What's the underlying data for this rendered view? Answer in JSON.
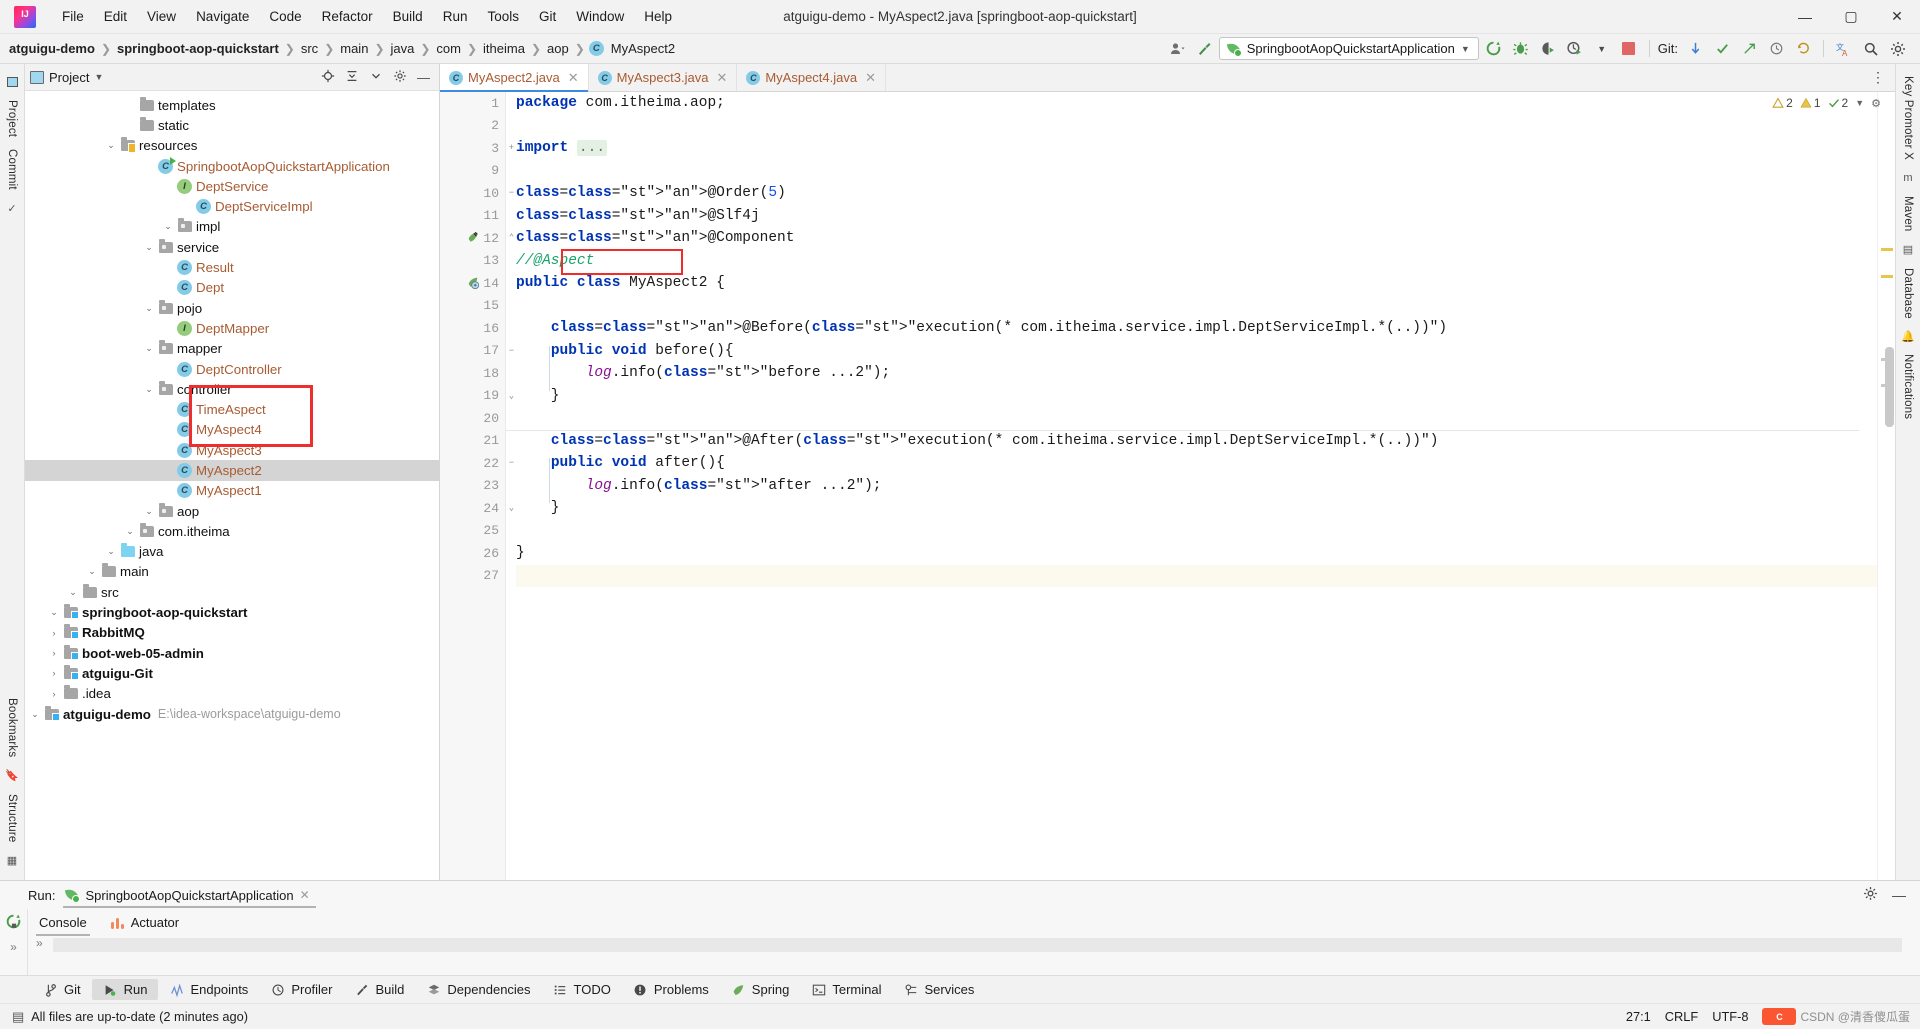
{
  "window": {
    "title": "atguigu-demo - MyAspect2.java [springboot-aop-quickstart]",
    "minimize": "—",
    "maximize": "▢",
    "close": "✕"
  },
  "menu": [
    "File",
    "Edit",
    "View",
    "Navigate",
    "Code",
    "Refactor",
    "Build",
    "Run",
    "Tools",
    "Git",
    "Window",
    "Help"
  ],
  "breadcrumb": [
    "atguigu-demo",
    "springboot-aop-quickstart",
    "src",
    "main",
    "java",
    "com",
    "itheima",
    "aop",
    "MyAspect2"
  ],
  "toolbar": {
    "run_config": "SpringbootAopQuickstartApplication",
    "git_label": "Git:",
    "icons": [
      "user-icon",
      "hammer-icon",
      "rerun-icon",
      "debug-icon",
      "coverage-icon",
      "profile-icon",
      "stop-icon",
      "git-update-icon",
      "git-commit-icon",
      "git-push-icon",
      "git-history-icon",
      "git-rollback-icon",
      "translate-icon",
      "search-icon",
      "settings-icon"
    ]
  },
  "project_panel": {
    "title": "Project",
    "header_icons": [
      "locate-icon",
      "collapse-all-icon",
      "expand-icon",
      "settings-icon",
      "hide-icon"
    ],
    "tree": [
      {
        "depth": 0,
        "label": "atguigu-demo",
        "path": "E:\\idea-workspace\\atguigu-demo",
        "icon": "module-folder",
        "arrow": "open",
        "bold": true
      },
      {
        "depth": 1,
        "label": ".idea",
        "icon": "folder",
        "arrow": "closed"
      },
      {
        "depth": 1,
        "label": "atguigu-Git",
        "icon": "module-folder",
        "arrow": "closed",
        "bold": true
      },
      {
        "depth": 1,
        "label": "boot-web-05-admin",
        "icon": "module-folder",
        "arrow": "closed",
        "bold": true
      },
      {
        "depth": 1,
        "label": "RabbitMQ",
        "icon": "module-folder",
        "arrow": "closed",
        "bold": true
      },
      {
        "depth": 1,
        "label": "springboot-aop-quickstart",
        "icon": "module-folder",
        "arrow": "open",
        "bold": true
      },
      {
        "depth": 2,
        "label": "src",
        "icon": "folder",
        "arrow": "open"
      },
      {
        "depth": 3,
        "label": "main",
        "icon": "folder",
        "arrow": "open"
      },
      {
        "depth": 4,
        "label": "java",
        "icon": "source-folder",
        "arrow": "open"
      },
      {
        "depth": 5,
        "label": "com.itheima",
        "icon": "package",
        "arrow": "open"
      },
      {
        "depth": 6,
        "label": "aop",
        "icon": "package",
        "arrow": "open"
      },
      {
        "depth": 7,
        "label": "MyAspect1",
        "icon": "class",
        "java": true
      },
      {
        "depth": 7,
        "label": "MyAspect2",
        "icon": "class",
        "java": true,
        "selected": true
      },
      {
        "depth": 7,
        "label": "MyAspect3",
        "icon": "class",
        "java": true
      },
      {
        "depth": 7,
        "label": "MyAspect4",
        "icon": "class",
        "java": true
      },
      {
        "depth": 7,
        "label": "TimeAspect",
        "icon": "class",
        "java": true
      },
      {
        "depth": 6,
        "label": "controller",
        "icon": "package",
        "arrow": "open"
      },
      {
        "depth": 7,
        "label": "DeptController",
        "icon": "class",
        "java": true
      },
      {
        "depth": 6,
        "label": "mapper",
        "icon": "package",
        "arrow": "open"
      },
      {
        "depth": 7,
        "label": "DeptMapper",
        "icon": "interface",
        "java": true
      },
      {
        "depth": 6,
        "label": "pojo",
        "icon": "package",
        "arrow": "open"
      },
      {
        "depth": 7,
        "label": "Dept",
        "icon": "class",
        "java": true
      },
      {
        "depth": 7,
        "label": "Result",
        "icon": "class",
        "java": true
      },
      {
        "depth": 6,
        "label": "service",
        "icon": "package",
        "arrow": "open"
      },
      {
        "depth": 7,
        "label": "impl",
        "icon": "package",
        "arrow": "open"
      },
      {
        "depth": 8,
        "label": "DeptServiceImpl",
        "icon": "class",
        "java": true
      },
      {
        "depth": 7,
        "label": "DeptService",
        "icon": "interface",
        "java": true
      },
      {
        "depth": 6,
        "label": "SpringbootAopQuickstartApplication",
        "icon": "runnable-class",
        "java": true
      },
      {
        "depth": 4,
        "label": "resources",
        "icon": "resource-folder",
        "arrow": "open"
      },
      {
        "depth": 5,
        "label": "static",
        "icon": "folder"
      },
      {
        "depth": 5,
        "label": "templates",
        "icon": "folder"
      }
    ],
    "highlight_note": "red box around MyAspect2, MyAspect3, MyAspect4"
  },
  "editor": {
    "tabs": [
      {
        "label": "MyAspect2.java",
        "active": true
      },
      {
        "label": "MyAspect3.java",
        "active": false
      },
      {
        "label": "MyAspect4.java",
        "active": false
      }
    ],
    "inspection": {
      "warnings": "2",
      "weak_warnings": "1",
      "ok": "2"
    },
    "lines": [
      {
        "n": "1",
        "text": "package com.itheima.aop;"
      },
      {
        "n": "2",
        "text": ""
      },
      {
        "n": "3",
        "text": "import ..."
      },
      {
        "n": "9",
        "text": ""
      },
      {
        "n": "10",
        "text": "@Order(5)"
      },
      {
        "n": "11",
        "text": "@Slf4j"
      },
      {
        "n": "12",
        "text": "@Component"
      },
      {
        "n": "13",
        "text": "//@Aspect"
      },
      {
        "n": "14",
        "text": "public class MyAspect2 {"
      },
      {
        "n": "15",
        "text": ""
      },
      {
        "n": "16",
        "text": "    @Before(\"execution(* com.itheima.service.impl.DeptServiceImpl.*(..))\")"
      },
      {
        "n": "17",
        "text": "    public void before(){"
      },
      {
        "n": "18",
        "text": "        log.info(\"before ...2\");"
      },
      {
        "n": "19",
        "text": "    }"
      },
      {
        "n": "20",
        "text": ""
      },
      {
        "n": "21",
        "text": "    @After(\"execution(* com.itheima.service.impl.DeptServiceImpl.*(..))\")"
      },
      {
        "n": "22",
        "text": "    public void after(){"
      },
      {
        "n": "23",
        "text": "        log.info(\"after ...2\");"
      },
      {
        "n": "24",
        "text": "    }"
      },
      {
        "n": "25",
        "text": ""
      },
      {
        "n": "26",
        "text": "}"
      },
      {
        "n": "27",
        "text": ""
      }
    ],
    "highlight_note": "red box around line 13 //@Aspect"
  },
  "run_window": {
    "label": "Run:",
    "config_name": "SpringbootAopQuickstartApplication",
    "close": "✕",
    "tabs": [
      {
        "label": "Console",
        "active": true
      },
      {
        "label": "Actuator",
        "active": false
      }
    ],
    "right_icons": [
      "settings-icon",
      "minimize-icon"
    ]
  },
  "bottom_strip": [
    {
      "label": "Git",
      "icon": "git-branch-icon",
      "active": false
    },
    {
      "label": "Run",
      "icon": "run-icon",
      "active": true
    },
    {
      "label": "Endpoints",
      "icon": "endpoints-icon",
      "active": false
    },
    {
      "label": "Profiler",
      "icon": "profiler-icon",
      "active": false
    },
    {
      "label": "Build",
      "icon": "build-hammer-icon",
      "active": false
    },
    {
      "label": "Dependencies",
      "icon": "dependencies-icon",
      "active": false
    },
    {
      "label": "TODO",
      "icon": "todo-icon",
      "active": false
    },
    {
      "label": "Problems",
      "icon": "problems-icon",
      "active": false
    },
    {
      "label": "Spring",
      "icon": "spring-leaf-icon",
      "active": false
    },
    {
      "label": "Terminal",
      "icon": "terminal-icon",
      "active": false
    },
    {
      "label": "Services",
      "icon": "services-icon",
      "active": false
    }
  ],
  "status_bar": {
    "message": "All files are up-to-date (2 minutes ago)",
    "caret": "27:1",
    "line_sep": "CRLF",
    "encoding": "UTF-8",
    "watermark": "CSDN @清香傻瓜蛋"
  },
  "left_rail": [
    "Project",
    "Commit",
    "Bookmarks",
    "Structure"
  ],
  "right_rail": [
    "Key Promoter X",
    "Maven",
    "Database",
    "Notifications"
  ],
  "colors": {
    "accent_blue": "#3b8ce0",
    "red_box": "#f02d2d",
    "keyword": "#0033b3",
    "string": "#067d17",
    "annotation": "#9e880d",
    "comment": "#19a36a",
    "field": "#871094",
    "java_file": "#a85b32"
  }
}
